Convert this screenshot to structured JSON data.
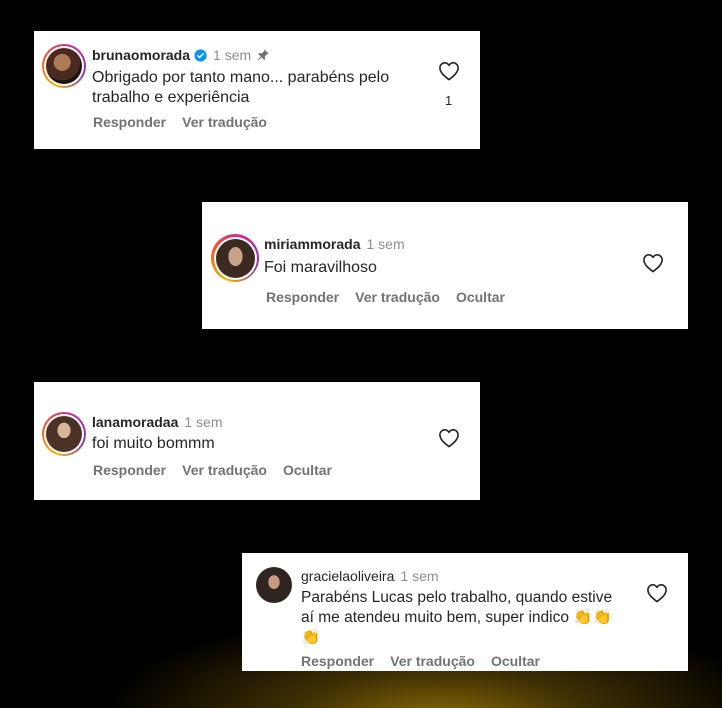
{
  "comments": [
    {
      "username": "brunaomorada",
      "time": "1 sem",
      "verified": true,
      "pinned": true,
      "text": "Obrigado por tanto mano... parabéns pelo trabalho e experiência",
      "actions": [
        "Responder",
        "Ver tradução"
      ],
      "likes": "1"
    },
    {
      "username": "miriammorada",
      "time": "1 sem",
      "text": "Foi maravilhoso",
      "actions": [
        "Responder",
        "Ver tradução",
        "Ocultar"
      ]
    },
    {
      "username": "lanamoradaa",
      "time": "1 sem",
      "text": "foi muito bommm",
      "actions": [
        "Responder",
        "Ver tradução",
        "Ocultar"
      ]
    },
    {
      "username": "gracielaoliveira",
      "time": "1 sem",
      "text": "Parabéns Lucas pelo trabalho, quando estive aí me atendeu muito bem, super indico 👏👏👏",
      "actions": [
        "Responder",
        "Ver tradução",
        "Ocultar"
      ]
    }
  ],
  "icons": {
    "like": "heart-outline-icon",
    "verified": "verified-badge-icon",
    "pinned": "pin-icon"
  },
  "colors": {
    "verified": "#0095f6",
    "muted": "#8e8e8e",
    "text": "#262626"
  }
}
